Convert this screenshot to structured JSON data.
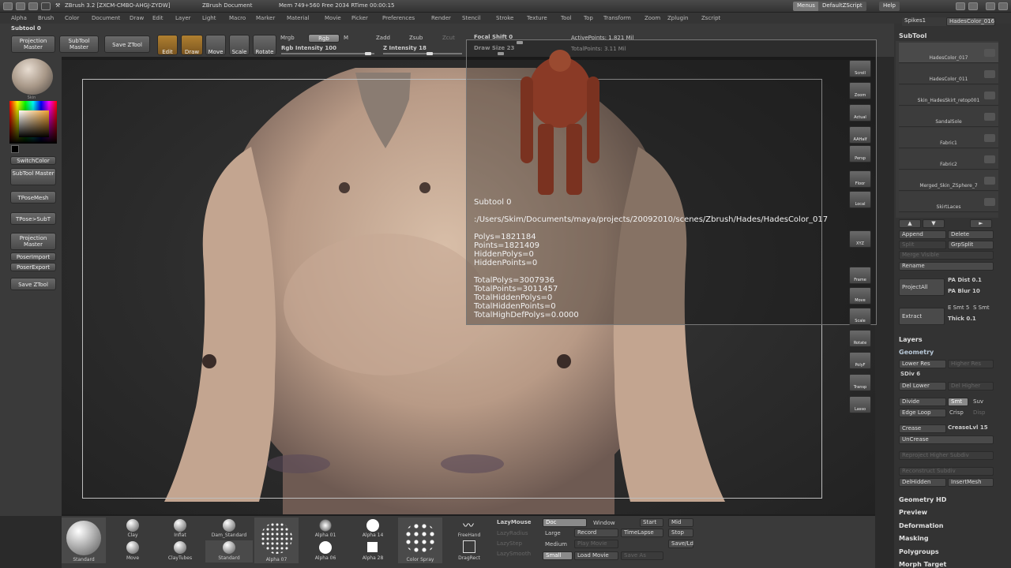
{
  "titlebar": {
    "app": "ZBrush 3.2 [ZXCM-CMBO-AHGJ-ZYDW]",
    "doc": "ZBrush Document",
    "mem": "Mem 749+560 Free 2034 RTime 00:00:15",
    "menus_btn": "Menus",
    "script_btn": "DefaultZScript",
    "help_btn": "Help"
  },
  "menubar": {
    "items": [
      "Alpha",
      "Brush",
      "Color",
      "Document",
      "Draw",
      "Edit",
      "Layer",
      "Light",
      "Macro",
      "Marker",
      "Material",
      "Movie",
      "Picker",
      "Preferences",
      "Render",
      "Stencil",
      "Stroke",
      "Texture",
      "Tool",
      "Top",
      "Transform",
      "Zoom",
      "Zplugin",
      "Zscript"
    ]
  },
  "topshelf": {
    "subtool_label": "Subtool 0",
    "projection_master": "Projection Master",
    "subtool_master": "SubTool Master",
    "save_ztool": "Save ZTool",
    "edit": "Edit",
    "draw": "Draw",
    "move": "Move",
    "scale": "Scale",
    "rotate": "Rotate",
    "mrgb": "Mrgb",
    "rgb": "Rgb",
    "m": "M",
    "rgb_intensity": "Rgb Intensity 100",
    "zadd": "Zadd",
    "zsub": "Zsub",
    "zcut": "Zcut",
    "z_intensity": "Z Intensity 18",
    "focal_shift": "Focal Shift 0",
    "draw_size": "Draw Size 23",
    "active_points": "ActivePoints: 1.821 Mil",
    "total_points": "TotalPoints: 3.11 Mil"
  },
  "leftshelf": {
    "material": "Skin",
    "switch_color": "SwitchColor",
    "subtool_master": "SubTool Master",
    "tpose_mesh": "TPoseMesh",
    "tpose_subt": "TPose>SubT",
    "projection_master": "Projection Master",
    "poser_import": "PoserImport",
    "poser_export": "PoserExport",
    "save_ztool": "Save ZTool"
  },
  "rightshelf": [
    "Scroll",
    "Zoom",
    "Actual",
    "AAHalf",
    "Persp",
    "Floor",
    "Local",
    "XYZ",
    "Frame",
    "Move",
    "Scale",
    "Rotate",
    "PolyF",
    "Transp",
    "Lasso"
  ],
  "info": {
    "title": "Subtool 0",
    "path": ":/Users/Skim/Documents/maya/projects/20092010/scenes/Zbrush/Hades/HadesColor_017",
    "lines": [
      "Polys=1821184",
      "Points=1821409",
      "HiddenPolys=0",
      "HiddenPoints=0",
      "TotalPolys=3007936",
      "TotalPoints=3011457",
      "TotalHiddenPolys=0",
      "TotalHiddenPoints=0",
      "TotalHighDefPolys=0.0000"
    ]
  },
  "tray": {
    "tabs": [
      "Spikes1",
      "HadesColor_016"
    ],
    "subtool_title": "SubTool",
    "subtools": [
      "HadesColor_017",
      "HadesColor_011",
      "Skin_HadesSkirt_retop001",
      "SandalSole",
      "Fabric1",
      "Fabric2",
      "Merged_Skin_ZSphere_7",
      "SkirtLaces"
    ],
    "append": "Append",
    "delete": "Delete",
    "split": "Split",
    "grpsplit": "GrpSplit",
    "merge_visible": "Merge Visible",
    "rename": "Rename",
    "project_all": "ProjectAll",
    "pa_dist": "PA Dist 0.1",
    "pa_blur": "PA Blur 10",
    "extract": "Extract",
    "e_smt": "E Smt 5",
    "s_smt": "S Smt",
    "thick": "Thick 0.1",
    "layers": "Layers",
    "geometry": "Geometry",
    "lower_res": "Lower Res",
    "higher_res": "Higher Res",
    "sdiv": "SDiv 6",
    "del_lower": "Del Lower",
    "del_higher": "Del Higher",
    "divide": "Divide",
    "smt": "Smt",
    "suv": "Suv",
    "edge_loop": "Edge Loop",
    "crisp": "Crisp",
    "disp": "Disp",
    "crease": "Crease",
    "creaselvl": "CreaseLvl 15",
    "uncrease": "UnCrease",
    "reproject": "Reproject Higher Subdiv",
    "reconstruct": "Reconstruct Subdiv",
    "del_hidden": "DelHidden",
    "insert_mesh": "InsertMesh",
    "sections": [
      "Geometry HD",
      "Preview",
      "Deformation",
      "Masking",
      "Polygroups",
      "Morph Target"
    ]
  },
  "bottom": {
    "brushes": [
      "Standard",
      "Clay",
      "Move",
      "Inflat",
      "ClayTubes",
      "Dam_Standard",
      "Standard",
      "Alpha 07",
      "Alpha 01",
      "Alpha 06",
      "Alpha 14",
      "Alpha 28",
      "Color Spray",
      "FreeHand",
      "DragRect"
    ],
    "lazymouse": "LazyMouse",
    "lazyradius": "LazyRadius",
    "lazystep": "LazyStep",
    "lazysmooth": "LazySmooth",
    "doc": "Doc",
    "window": "Window",
    "start": "Start",
    "mid": "Mid",
    "large": "Large",
    "record": "Record",
    "timelapse": "TimeLapse",
    "stop": "Stop",
    "medium": "Medium",
    "play_movie": "Play Movie",
    "save_ld": "Save/Ld",
    "small": "Small",
    "load_movie": "Load Movie",
    "save_as": "Save As"
  },
  "colors": {
    "accent": "#f0a030",
    "skin": "#c9ab96",
    "model_red": "#8a3a26"
  }
}
